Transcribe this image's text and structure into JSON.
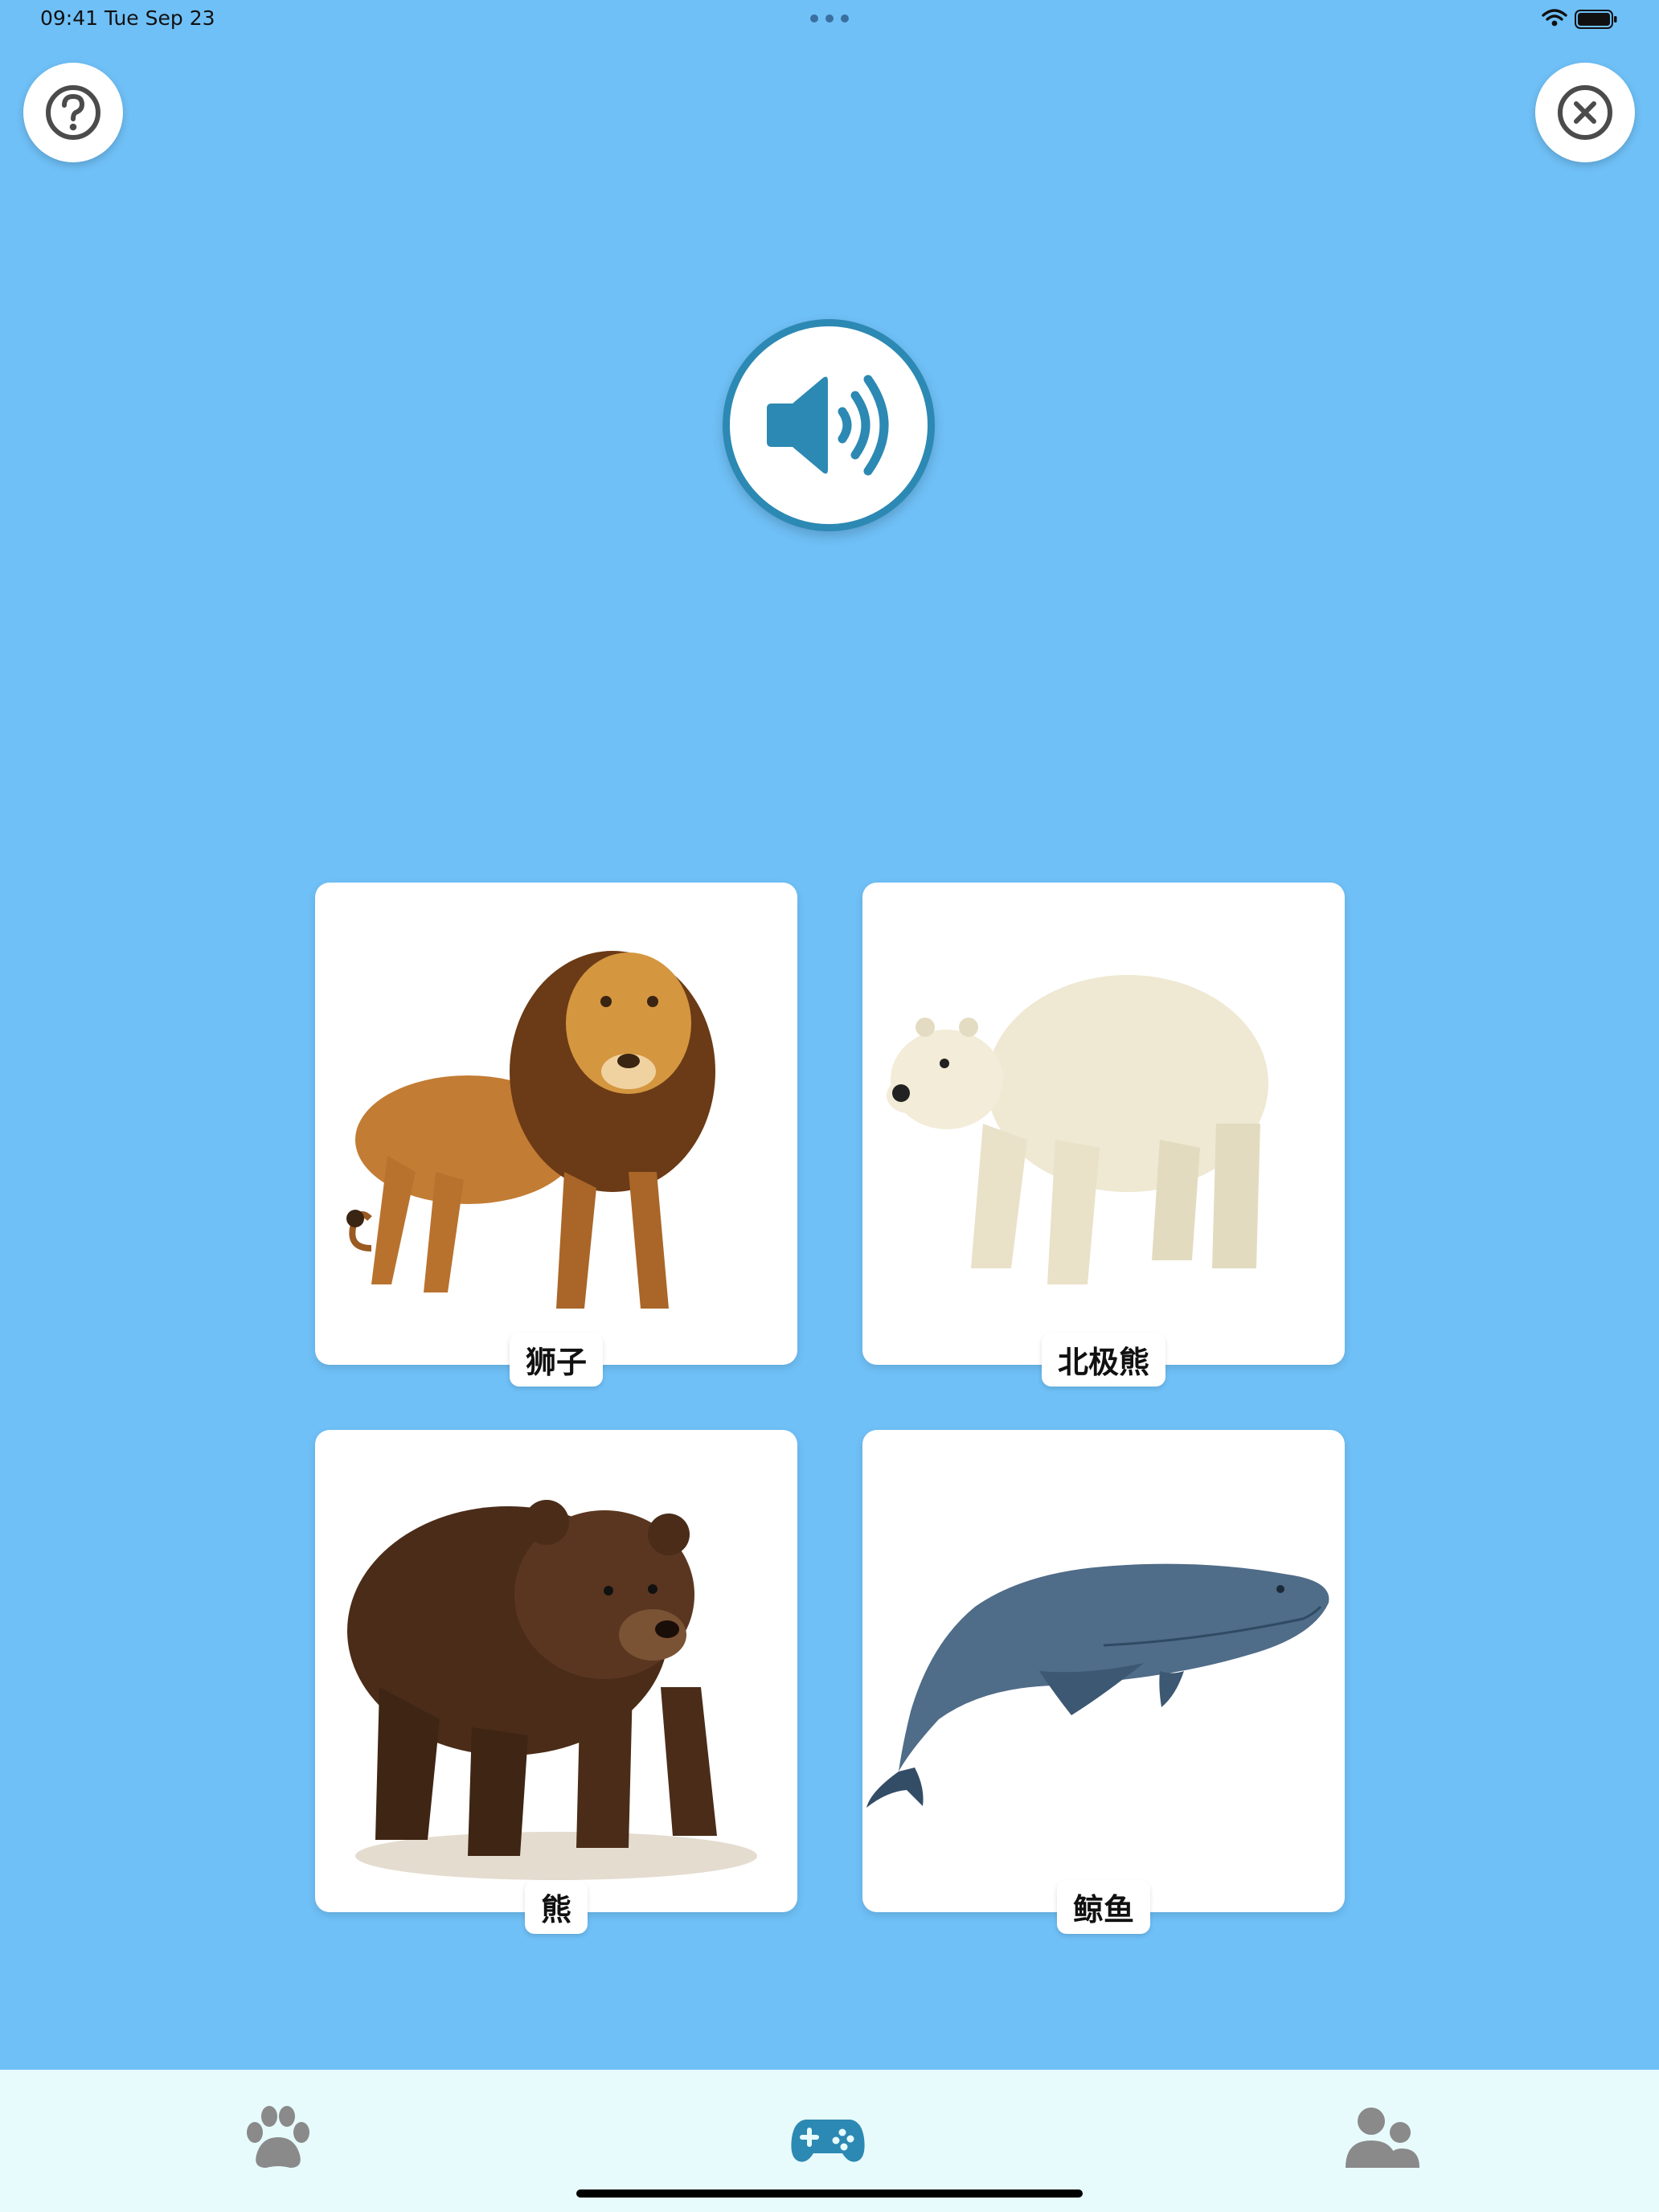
{
  "status_bar": {
    "time_date": "09:41  Tue Sep 23",
    "icons": [
      "wifi-icon",
      "battery-icon"
    ]
  },
  "header": {
    "help_icon": "question-circle-icon",
    "close_icon": "close-circle-icon"
  },
  "audio": {
    "icon": "speaker-volume-icon",
    "accent_color": "#2c89b3"
  },
  "cards": [
    {
      "label": "狮子",
      "image": "lion"
    },
    {
      "label": "北极熊",
      "image": "polar-bear"
    },
    {
      "label": "熊",
      "image": "brown-bear"
    },
    {
      "label": "鲸鱼",
      "image": "whale"
    }
  ],
  "tab_bar": {
    "tabs": [
      {
        "icon": "paw-icon",
        "active": false
      },
      {
        "icon": "gamepad-icon",
        "active": true
      },
      {
        "icon": "users-icon",
        "active": false
      }
    ],
    "active_color": "#2c89b3",
    "inactive_color": "#8a8a8a"
  },
  "colors": {
    "background": "#6fc0f7",
    "tab_bar_background": "#e8fbfc"
  }
}
